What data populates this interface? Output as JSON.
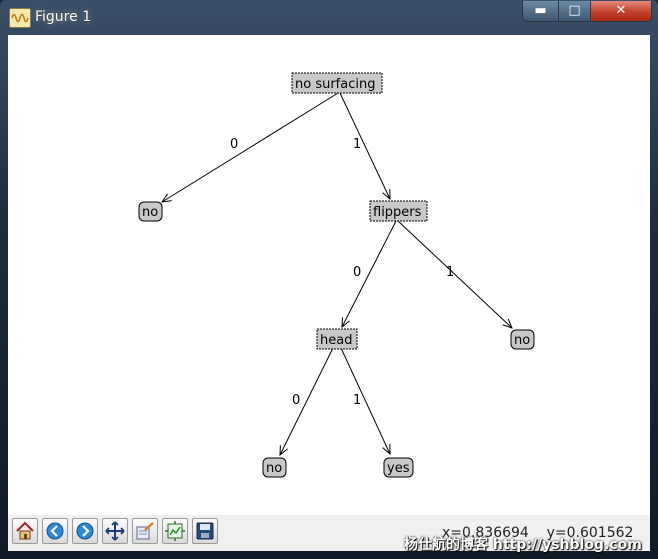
{
  "window": {
    "title": "Figure 1",
    "min_glyph": "▬",
    "max_glyph": "□",
    "close_glyph": "✕"
  },
  "tree": {
    "nodes": {
      "root": {
        "label": "no surfacing",
        "kind": "decision"
      },
      "root_leaf": {
        "label": "no",
        "kind": "leaf"
      },
      "flippers": {
        "label": "flippers",
        "kind": "decision"
      },
      "head": {
        "label": "head",
        "kind": "decision"
      },
      "flippers_leaf": {
        "label": "no",
        "kind": "leaf"
      },
      "head_leaf_no": {
        "label": "no",
        "kind": "leaf"
      },
      "head_leaf_yes": {
        "label": "yes",
        "kind": "leaf"
      }
    },
    "edges": [
      {
        "from": "root",
        "to": "root_leaf",
        "label": "0"
      },
      {
        "from": "root",
        "to": "flippers",
        "label": "1"
      },
      {
        "from": "flippers",
        "to": "head",
        "label": "0"
      },
      {
        "from": "flippers",
        "to": "flippers_leaf",
        "label": "1"
      },
      {
        "from": "head",
        "to": "head_leaf_no",
        "label": "0"
      },
      {
        "from": "head",
        "to": "head_leaf_yes",
        "label": "1"
      }
    ]
  },
  "toolbar": {
    "buttons": [
      "home-icon",
      "back-arrow-icon",
      "forward-arrow-icon",
      "pan-icon",
      "zoom-icon",
      "subplots-icon",
      "save-icon"
    ],
    "coords": "x=0.836694    y=0.601562"
  },
  "watermark": "杨仕航的博客 http://yshblog.com"
}
